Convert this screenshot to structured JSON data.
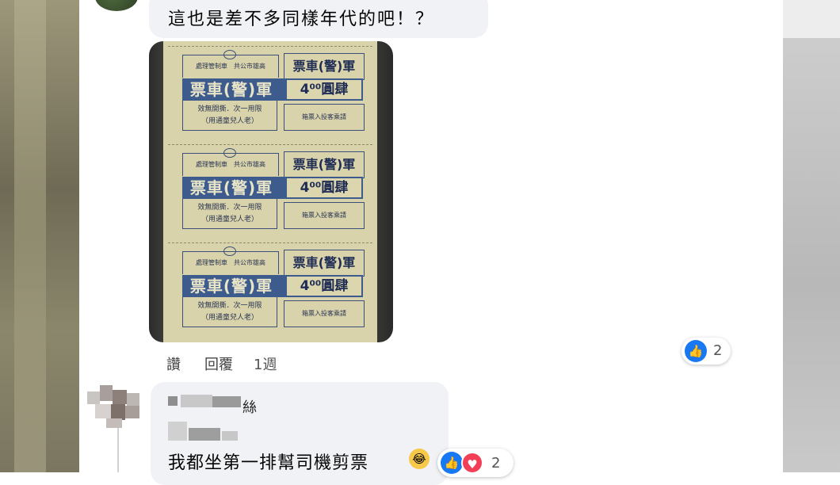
{
  "comment1": {
    "text": "這也是差不多同樣年代的吧！？",
    "actions": {
      "like": "讚",
      "reply": "回覆",
      "time": "1週"
    },
    "reactions": {
      "count": "2",
      "icon": "thumbs-up-icon"
    }
  },
  "ticket": {
    "top_left": "處理管制車　共公市雄高",
    "top_right": "票車(警)軍",
    "band_left": "票車(警)軍",
    "band_right": "4⁰⁰圓肆",
    "bottom_left_1": "效無開撕．次一用限",
    "bottom_left_2": "（用通童兒人老）",
    "bottom_right": "箱票入投客乘請"
  },
  "comment2": {
    "name_suffix": "絲",
    "text": "我都坐第一排幫司機剪票",
    "emoji": "😂",
    "reactions": {
      "count": "2",
      "icons": [
        "thumbs-up-icon",
        "heart-icon"
      ]
    }
  },
  "colors": {
    "bubble": "#f0f2f5",
    "like_blue": "#1877f2",
    "heart_red": "#f33e58",
    "ticket_paper": "#d9d3ab",
    "ticket_ink": "#3d5b8c"
  }
}
